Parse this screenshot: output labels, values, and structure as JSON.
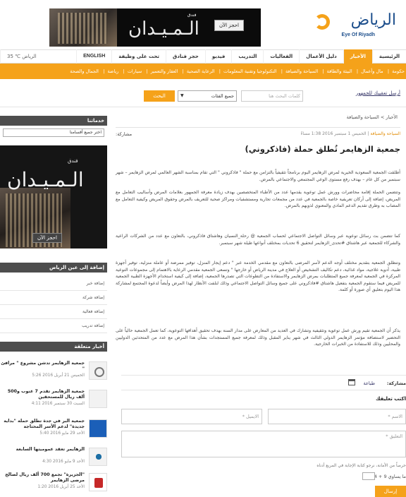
{
  "logo": {
    "text": "الرياض",
    "sub": "Eye Of Riyadh"
  },
  "top_ad": {
    "small": "فندق",
    "big": "الـمـيـدان",
    "button": "احجز الآن"
  },
  "nav": {
    "items": [
      "الرئيسية",
      "الأخبار",
      "دليل الأعمال",
      "الفعاليات",
      "التدريب",
      "فيديو",
      "حجز فنادق",
      "تحت على وظيفة",
      "ENGLISH"
    ],
    "active_index": 1,
    "weather": "الرياض ℃ 35"
  },
  "sub_nav": {
    "items": [
      "حكومة",
      "مال وأعمال",
      "البيئة والطاقة",
      "السياحة والضيافة",
      "التكنولوجيا وتقنية المعلومات",
      "الرعاية الصحية",
      "العقار والتعمير",
      "سيارات",
      "رياضة",
      "الجمال والصحة"
    ]
  },
  "search": {
    "feedback_link": "أرسل تعقيبك للجمهور",
    "keyword_placeholder": "كلمات البحث هنا",
    "category_value": "جميع الفئات",
    "button": "البحث"
  },
  "breadcrumb": "الأخبار  >  السياحة والضيافة",
  "article": {
    "category": "السياحة والضيافة",
    "date": "الخميس 1 سبتمبر 2016 1:38 مساءً",
    "share_label": "مشاركة:",
    "title": "جمعية الزهايمر تُطلق حملة (فاذكروني)",
    "paragraphs": [
      "أطلقت الجمعية السعودية الخيرية لمرض الزهايمر اليوم برنامجاً تثقيفياً بالتزامن مع حملة \" فاذكروني \" التي تقام بمناسبة الشهر العالمي لمرض الزهايمر – شهر سبتمبر من كل عام – بهدف رفع مستوى الوعي المجتمعي والاجتماعي بالمرض.",
      "وتتضمن الحملة إقامة محاضرات وورش عمل توعوية يقدمها عدد من الأطباء المتخصصين بهدف زيادة معرفة الجمهور بعلامات المرض وأساليب التعامل مع المريض، إضافة إلى أركان تعريفية خاصة بالجمعية في عدد من مجمعات تجارية ومستشفيات ومراكز صحية للتعريف بالمرض وحقوق المريض وكيفية التعامل مع المصاب به وطرق تقديم الدعم المادي والمعنوي لذويهم بالمرض.",
      "كما تتضمن بث رسائل توعوية عبر وسائل التواصل الاجتماعي لحساب الجمعية @ رحلة_النسيان وهاشتاق فاذكروني، بالتعاون مع عدد من الشركات الراعية والشركاء للجمعية عبر هاشتاق #تحدى_الزهايمر لتحقيق 6 تحديات بمختلف أنواعها طيلة شهر سبتمبر.",
      "وتنطلق الجمعية بتقديم مختلف أوجه الدعم لأسر المرضى بالتعاون مع مقدمي الخدمة عبر \" دعم إيجار المنزل، توفير ممرضة أو عاملة منزلية، توفير أجهزة طبية، أدوية علاجية، مواد غذائية، دعم تكاليف التشخيص أو العلاج في مدينة الرياض أو خارجها \" وتسعى الجمعية مقدمي الرعاية بالاهتمام إلى مجموعات التوعية المركزة في الجمعية لمعرفة جميع المتطلبات بمرض الزهايمر والاستفادة من التطوعات التي تصدرها الجمعية، إضافة إلى كيفية استخدام الأجهزة الطبية الجمعية للمريض فيما ستقوم الجمعية بتفعيل هاشتاق #فاذكروني على جميع وسائل التواصل الاجتماعي وذلك لنلفت الأنظار لهذا المرض وأيضاً لدعوة المجتمع لمشاركة هذا اليوم بتعليق أي صورة أو كلمة.",
      "يذكر أن الجمعية تقيم ورش عمل توعوية وتثقيفية وتشارك في العديد من المعارض على مدار السنة بهدف تحقيق أهدافها التوعوية، كما تعمل الجمعية حالياً على التحضير لاستضافة مؤتمر الزهايمر الدولي الثالث في شهر يناير المقبل وذلك لمعرفة جميع المستجدات بشأن هذا المرض مع عدد من المتحدثين الدوليين والمحليين وذلك للاستفادة من الخبرات الخارجية."
    ],
    "share_footer": "مشاركة:",
    "print": "طباعة"
  },
  "comment_form": {
    "heading": "اكتب تعليقك",
    "name_placeholder": "الاسم *",
    "email_placeholder": "الايميل *",
    "comment_placeholder": "التعليق *",
    "note": "حرصاً من الأمانة، نرجو كتابة الإجابة في المربع أدناه",
    "captcha_text": "ما يساوي 9 + 4 =",
    "submit": "إرسال"
  },
  "sidebar": {
    "services_heading": "خدماتنا",
    "services_select": "اختر جميع أقسامنا",
    "ad": {
      "small": "فندق",
      "big": "الـمـيـدان",
      "button": "احجز الآن"
    },
    "add_heading": "إضافة إلى عين الرياض",
    "add_items": [
      "إضافة خبر",
      "إضافة شركة",
      "إضافة فعالية",
      "إضافة تدريب"
    ],
    "news_heading": "أخبار متعلقة",
    "news": [
      {
        "title": "جمعية الزهايمر تدشن مشروع \" مرافئ \"",
        "date": "الخميس 21 أبريل 2016 5:26"
      },
      {
        "title": "جمعية الزهايمر تقدم 7 عنوب و500 ألف ريال للمستحقين",
        "date": "السبت 30 سبتمبر 2016 4:11"
      },
      {
        "title": "جمعية البر في جدة تطلق حملة \"بداية جديدة\" لدعم الأسر المحتاجة",
        "date": "الأحد 29 مايو 2016 5:40"
      },
      {
        "title": "الزهايمر تعقد عموميتها السابعة",
        "date": "الأحد 9 مايو 2016 4:30"
      },
      {
        "title": "\"الجزيرة\" تجمع 700 ألف ريال لصالح مرضى الزهايمر",
        "date": "الأحد 25 أبريل 2016 1:20"
      }
    ]
  },
  "colors": {
    "accent": "#f5a21a",
    "dark_header": "#4d4d4d",
    "brand_blue": "#1d4f8c"
  }
}
